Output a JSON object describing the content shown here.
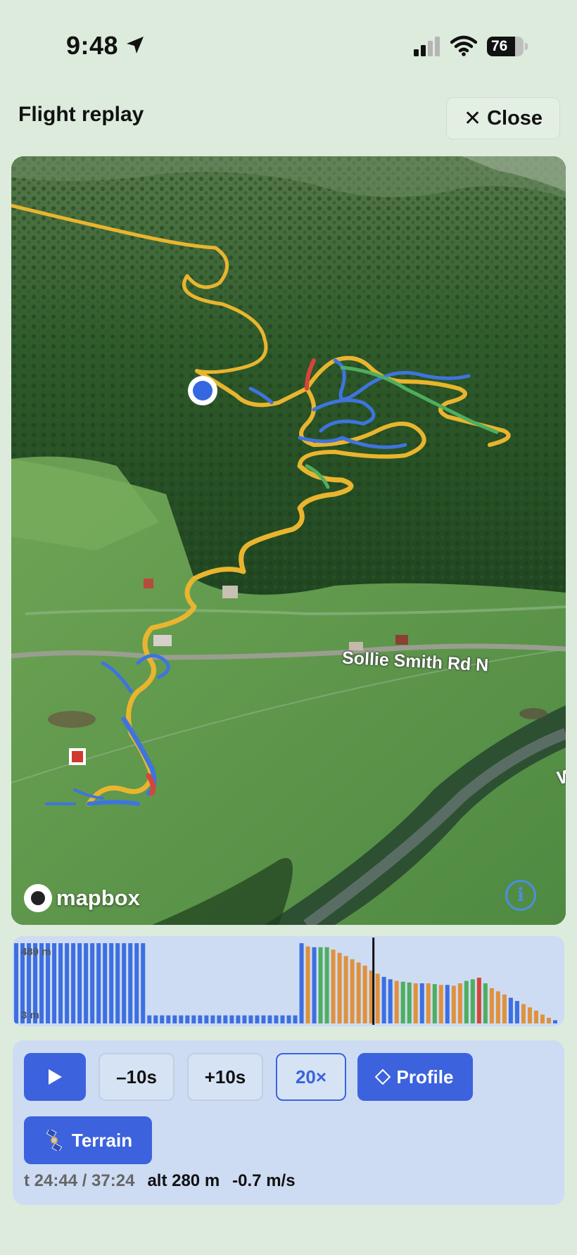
{
  "status_bar": {
    "time": "9:48",
    "battery": "76",
    "battery_level": 0.76
  },
  "header": {
    "title": "Flight replay",
    "close_label": "Close"
  },
  "map": {
    "road_label": "Sollie Smith Rd N",
    "edge_label": "W",
    "attribution": "mapbox",
    "info_label": "i"
  },
  "chart": {
    "y_max_label": "489 m",
    "y_min_label": "3 m",
    "colors": {
      "blue": "#3d6fe0",
      "green": "#4eae5f",
      "orange": "#e0913c",
      "red": "#d6453a"
    }
  },
  "controls": {
    "rewind_label": "–10s",
    "forward_label": "+10s",
    "speed_label": "20×",
    "profile_label": "Profile",
    "terrain_label": "Terrain",
    "time_readout": "t 24:44 / 37:24",
    "alt_readout": "alt 280 m",
    "vspeed_readout": "-0.7 m/s"
  },
  "colors": {
    "background": "#dcebdc",
    "accent": "#3c63dd",
    "panel": "#cddcf3"
  }
}
